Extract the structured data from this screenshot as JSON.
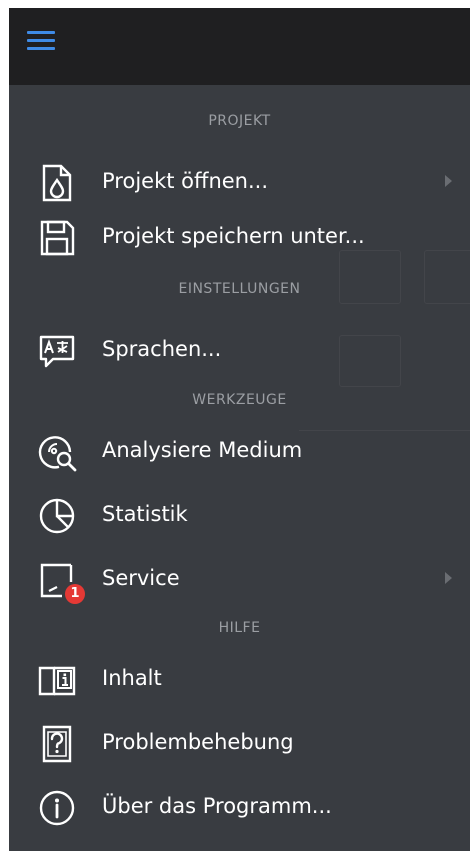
{
  "menu": {
    "sections": {
      "projekt": "PROJEKT",
      "einstellungen": "EINSTELLUNGEN",
      "werkzeuge": "WERKZEUGE",
      "hilfe": "HILFE"
    },
    "items": {
      "open": {
        "label": "Projekt öffnen...",
        "icon": "open-document-icon",
        "has_submenu": true
      },
      "save_as": {
        "label": "Projekt speichern unter...",
        "icon": "floppy-disk-icon"
      },
      "languages": {
        "label": "Sprachen...",
        "icon": "translate-icon"
      },
      "analyze": {
        "label": "Analysiere Medium",
        "icon": "disc-search-icon"
      },
      "statistics": {
        "label": "Statistik",
        "icon": "pie-chart-icon"
      },
      "service": {
        "label": "Service",
        "icon": "service-icon",
        "badge": "1",
        "has_submenu": true
      },
      "contents": {
        "label": "Inhalt",
        "icon": "book-info-icon"
      },
      "troubleshooting": {
        "label": "Problembehebung",
        "icon": "help-document-icon"
      },
      "about": {
        "label": "Über das Programm...",
        "icon": "info-circle-icon"
      }
    }
  },
  "colors": {
    "accent": "#3f8be6",
    "badge": "#e53935",
    "menu_bg": "#393c41",
    "topbar_bg": "#1f1f21"
  }
}
